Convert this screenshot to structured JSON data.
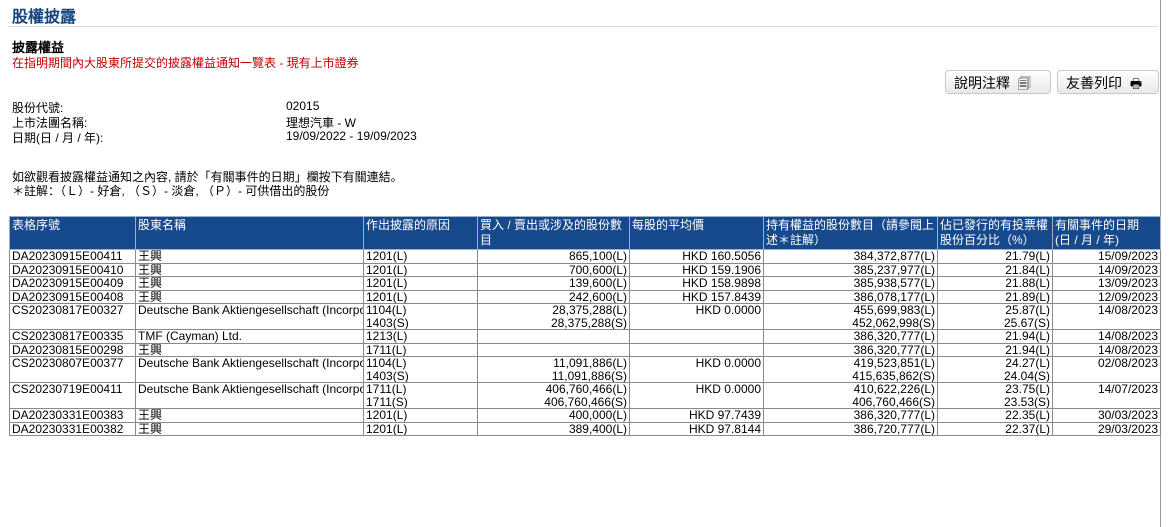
{
  "page": {
    "title": "股權披露",
    "subtitle": "披露權益",
    "description": "在指明期間內大股東所提交的披露權益通知一覽表 - 現有上市證券"
  },
  "toolbar": {
    "notes_label": "說明注釋",
    "notes_icon": "document-icon",
    "print_label": "友善列印",
    "print_icon": "printer-icon"
  },
  "info": {
    "code_label": "股份代號:",
    "code_value": "02015",
    "name_label": "上市法團名稱:",
    "name_value": "理想汽車 - W",
    "date_label": "日期(日 / 月 / 年):",
    "date_value": "19/09/2022 - 19/09/2023"
  },
  "notes": {
    "line1": "如欲觀看披露權益通知之內容, 請於「有關事件的日期」欄按下有關連結。",
    "line2": "＊註解：（Ｌ）- 好倉, （Ｓ）- 淡倉, （Ｐ）- 可供借出的股份"
  },
  "table": {
    "headers": [
      "表格序號",
      "股東名稱",
      "作出披露的原因",
      "買入 / 賣出或涉及的股份數目",
      "每股的平均價",
      "持有權益的股份數目（請參閱上述＊註解）",
      "佔已發行的有投票權股份百分比（%）",
      "有關事件的日期 (日 / 月 / 年)"
    ],
    "rows": [
      {
        "form": "DA20230915E00411",
        "name": "王興",
        "reason": "1201(L)",
        "shares": "865,100(L)",
        "price": "HKD 160.5056",
        "holding": "384,372,877(L)",
        "pct": "21.79(L)",
        "date": "15/09/2023"
      },
      {
        "form": "DA20230915E00410",
        "name": "王興",
        "reason": "1201(L)",
        "shares": "700,600(L)",
        "price": "HKD 159.1906",
        "holding": "385,237,977(L)",
        "pct": "21.84(L)",
        "date": "14/09/2023"
      },
      {
        "form": "DA20230915E00409",
        "name": "王興",
        "reason": "1201(L)",
        "shares": "139,600(L)",
        "price": "HKD 158.9898",
        "holding": "385,938,577(L)",
        "pct": "21.88(L)",
        "date": "13/09/2023"
      },
      {
        "form": "DA20230915E00408",
        "name": "王興",
        "reason": "1201(L)",
        "shares": "242,600(L)",
        "price": "HKD 157.8439",
        "holding": "386,078,177(L)",
        "pct": "21.89(L)",
        "date": "12/09/2023"
      },
      {
        "form": "CS20230817E00327",
        "name": "Deutsche Bank Aktiengesellschaft (Incorporated in the Federal Republic of Germany & members' liability is limited)",
        "reason": "1104(L)\n1403(S)",
        "shares": "28,375,288(L)\n28,375,288(S)",
        "price": "HKD 0.0000",
        "holding": "455,699,983(L)\n452,062,998(S)",
        "pct": "25.87(L)\n25.67(S)",
        "date": "14/08/2023"
      },
      {
        "form": "CS20230817E00335",
        "name": "TMF (Cayman) Ltd.",
        "reason": "1213(L)",
        "shares": "",
        "price": "",
        "holding": "386,320,777(L)",
        "pct": "21.94(L)",
        "date": "14/08/2023"
      },
      {
        "form": "DA20230815E00298",
        "name": "王興",
        "reason": "1711(L)",
        "shares": "",
        "price": "",
        "holding": "386,320,777(L)",
        "pct": "21.94(L)",
        "date": "14/08/2023"
      },
      {
        "form": "CS20230807E00377",
        "name": "Deutsche Bank Aktiengesellschaft (Incorporated in the Federal Republic of Germany & members' liability is limited)",
        "reason": "1104(L)\n1403(S)",
        "shares": "11,091,886(L)\n11,091,886(S)",
        "price": "HKD 0.0000",
        "holding": "419,523,851(L)\n415,635,862(S)",
        "pct": "24.27(L)\n24.04(S)",
        "date": "02/08/2023"
      },
      {
        "form": "CS20230719E00411",
        "name": "Deutsche Bank Aktiengesellschaft (Incorporated in the Federal Republic of Germany & members' liability is limited)",
        "reason": "1711(L)\n1711(S)",
        "shares": "406,760,466(L)\n406,760,466(S)",
        "price": "HKD 0.0000",
        "holding": "410,622,226(L)\n406,760,466(S)",
        "pct": "23.75(L)\n23.53(S)",
        "date": "14/07/2023"
      },
      {
        "form": "DA20230331E00383",
        "name": "王興",
        "reason": "1201(L)",
        "shares": "400,000(L)",
        "price": "HKD 97.7439",
        "holding": "386,320,777(L)",
        "pct": "22.35(L)",
        "date": "30/03/2023"
      },
      {
        "form": "DA20230331E00382",
        "name": "王興",
        "reason": "1201(L)",
        "shares": "389,400(L)",
        "price": "HKD 97.8144",
        "holding": "386,720,777(L)",
        "pct": "22.37(L)",
        "date": "29/03/2023"
      }
    ]
  },
  "colors": {
    "title": "#15457f",
    "description": "#c00000",
    "header_bg": "#174a8c",
    "link": "#2b56a5"
  }
}
